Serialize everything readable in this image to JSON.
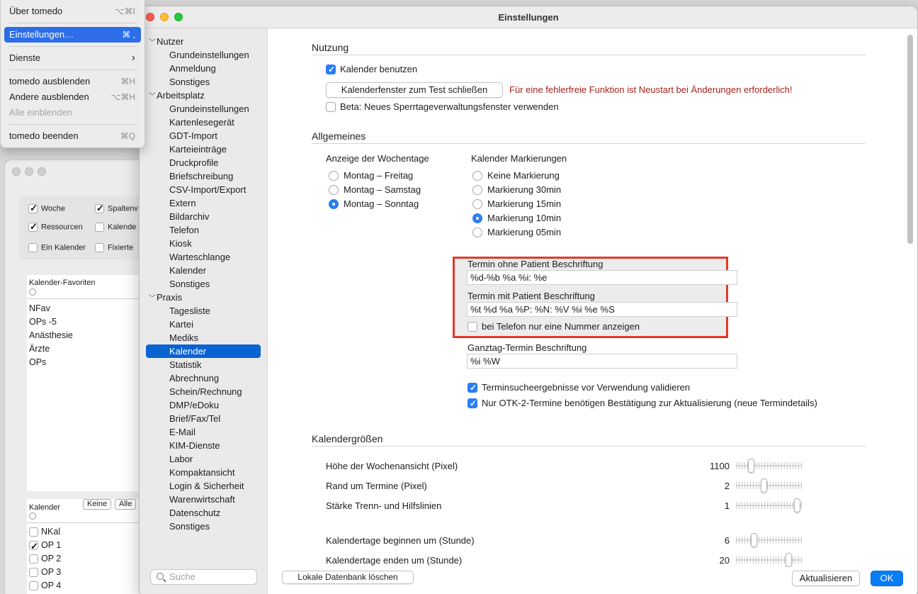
{
  "menu": {
    "items": [
      {
        "label": "Über tomedo",
        "shortcut": "⌥⌘I"
      },
      {
        "label": "Einstellungen…",
        "shortcut": "⌘ ,"
      },
      {
        "label": "Dienste",
        "shortcut": "›"
      },
      {
        "label": "tomedo ausblenden",
        "shortcut": "⌘H"
      },
      {
        "label": "Andere ausblenden",
        "shortcut": "⌥⌘H"
      },
      {
        "label": "Alle einblenden",
        "shortcut": ""
      },
      {
        "label": "tomedo beenden",
        "shortcut": "⌘Q"
      }
    ]
  },
  "bgwindow": {
    "options": [
      "Woche",
      "Spaltenv",
      "Ressourcen",
      "Kalende",
      "Ein Kalender",
      "Fixierte"
    ],
    "favorites_header": "Kalender-Favoriten",
    "favorites": [
      "NFav",
      "OPs -5",
      "Anästhesie",
      "Ärzte",
      "OPs"
    ],
    "kalender_header": "Kalender",
    "btn_keine": "Keine",
    "btn_alle": "Alle",
    "kalender": [
      "NKal",
      "OP 1",
      "OP 2",
      "OP 3",
      "OP 4"
    ]
  },
  "window": {
    "title": "Einstellungen"
  },
  "sidebar": {
    "sections": [
      {
        "label": "Nutzer",
        "items": [
          "Grundeinstellungen",
          "Anmeldung",
          "Sonstiges"
        ]
      },
      {
        "label": "Arbeitsplatz",
        "items": [
          "Grundeinstellungen",
          "Kartenlesegerät",
          "GDT-Import",
          "Karteieinträge",
          "Druckprofile",
          "Briefschreibung",
          "CSV-Import/Export",
          "Extern",
          "Bildarchiv",
          "Telefon",
          "Kiosk",
          "Warteschlange",
          "Kalender",
          "Sonstiges"
        ]
      },
      {
        "label": "Praxis",
        "items": [
          "Tagesliste",
          "Kartei",
          "Mediks",
          "Kalender",
          "Statistik",
          "Abrechnung",
          "Schein/Rechnung",
          "DMP/eDoku",
          "Brief/Fax/Tel",
          "E-Mail",
          "KIM-Dienste",
          "Labor",
          "Kompaktansicht",
          "Login & Sicherheit",
          "Warenwirtschaft",
          "Datenschutz",
          "Sonstiges"
        ]
      }
    ],
    "search_placeholder": "Suche"
  },
  "content": {
    "nutzung": {
      "heading": "Nutzung",
      "kalender_benutzen": "Kalender benutzen",
      "close_button": "Kalenderfenster zum Test schließen",
      "warning": "Für eine fehlerfreie Funktion ist Neustart bei Änderungen erforderlich!",
      "beta": "Beta: Neues Sperrtageverwaltungsfenster verwenden"
    },
    "allgemeines": {
      "heading": "Allgemeines",
      "wochentage_label": "Anzeige der Wochentage",
      "wochentage": [
        "Montag – Freitag",
        "Montag – Samstag",
        "Montag – Sonntag"
      ],
      "markierungen_label": "Kalender Markierungen",
      "markierungen": [
        "Keine Markierung",
        "Markierung 30min",
        "Markierung 15min",
        "Markierung 10min",
        "Markierung 05min"
      ],
      "ohne_patient_label": "Termin ohne Patient Beschriftung",
      "ohne_patient_value": "%d-%b %a %i: %e",
      "mit_patient_label": "Termin mit Patient Beschriftung",
      "mit_patient_value": "%t %d %a %P: %N: %V %i %e %S",
      "telefon_nummer": "bei Telefon nur eine Nummer anzeigen",
      "ganztag_label": "Ganztag-Termin Beschriftung",
      "ganztag_value": "%i %W",
      "validieren": "Terminsucheergebnisse vor Verwendung validieren",
      "otk": "Nur OTK-2-Termine benötigen Bestätigung zur Aktualisierung (neue Termindetails)"
    },
    "groessen": {
      "heading": "Kalendergrößen",
      "sliders": [
        {
          "label": "Höhe der Wochenansicht (Pixel)",
          "value": "1100",
          "fraction": 0.2
        },
        {
          "label": "Rand um Termine (Pixel)",
          "value": "2",
          "fraction": 0.42
        },
        {
          "label": "Stärke Trenn- und Hilfslinien",
          "value": "1",
          "fraction": 0.98
        },
        {
          "label": "Kalendertage beginnen um (Stunde)",
          "value": "6",
          "fraction": 0.25
        },
        {
          "label": "Kalendertage enden um (Stunde)",
          "value": "20",
          "fraction": 0.83
        }
      ]
    }
  },
  "footer": {
    "delete_db": "Lokale Datenbank löschen",
    "refresh": "Aktualisieren",
    "ok": "OK"
  }
}
